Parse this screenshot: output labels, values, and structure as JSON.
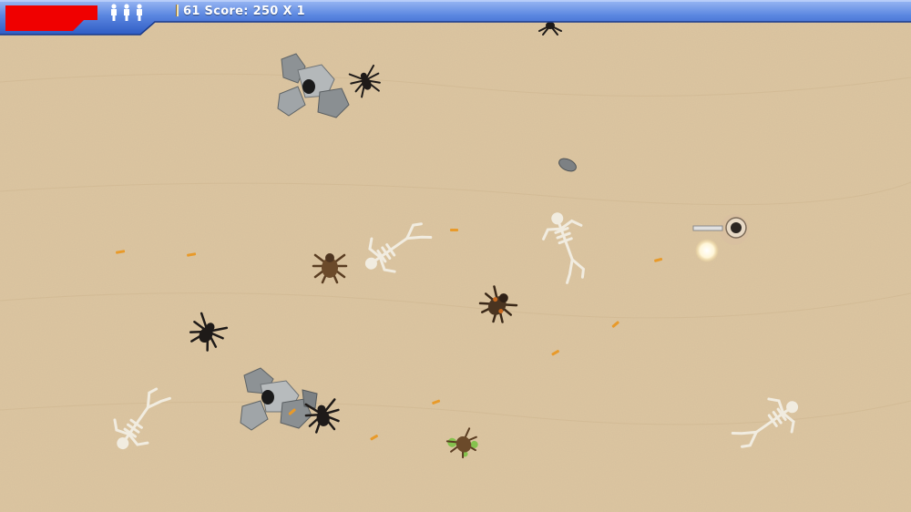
{
  "hud": {
    "ammo": "61",
    "score_label": "Score:",
    "score": "250",
    "multiplier": "X 1",
    "lives": 3,
    "health_fraction": 1.0,
    "colors": {
      "bar": "#3f6fd8",
      "bar_light": "#8fb0f0",
      "health": "#f00000",
      "text": "#ffffff"
    }
  },
  "colors": {
    "sand": "#dcc5a0",
    "sand_dark": "#c9b08a",
    "rock": "#8f9498",
    "bone": "#f1ece0",
    "spider": "#1e1a18",
    "brown_spider": "#5a3d22",
    "bullet": "#e89a2a"
  }
}
